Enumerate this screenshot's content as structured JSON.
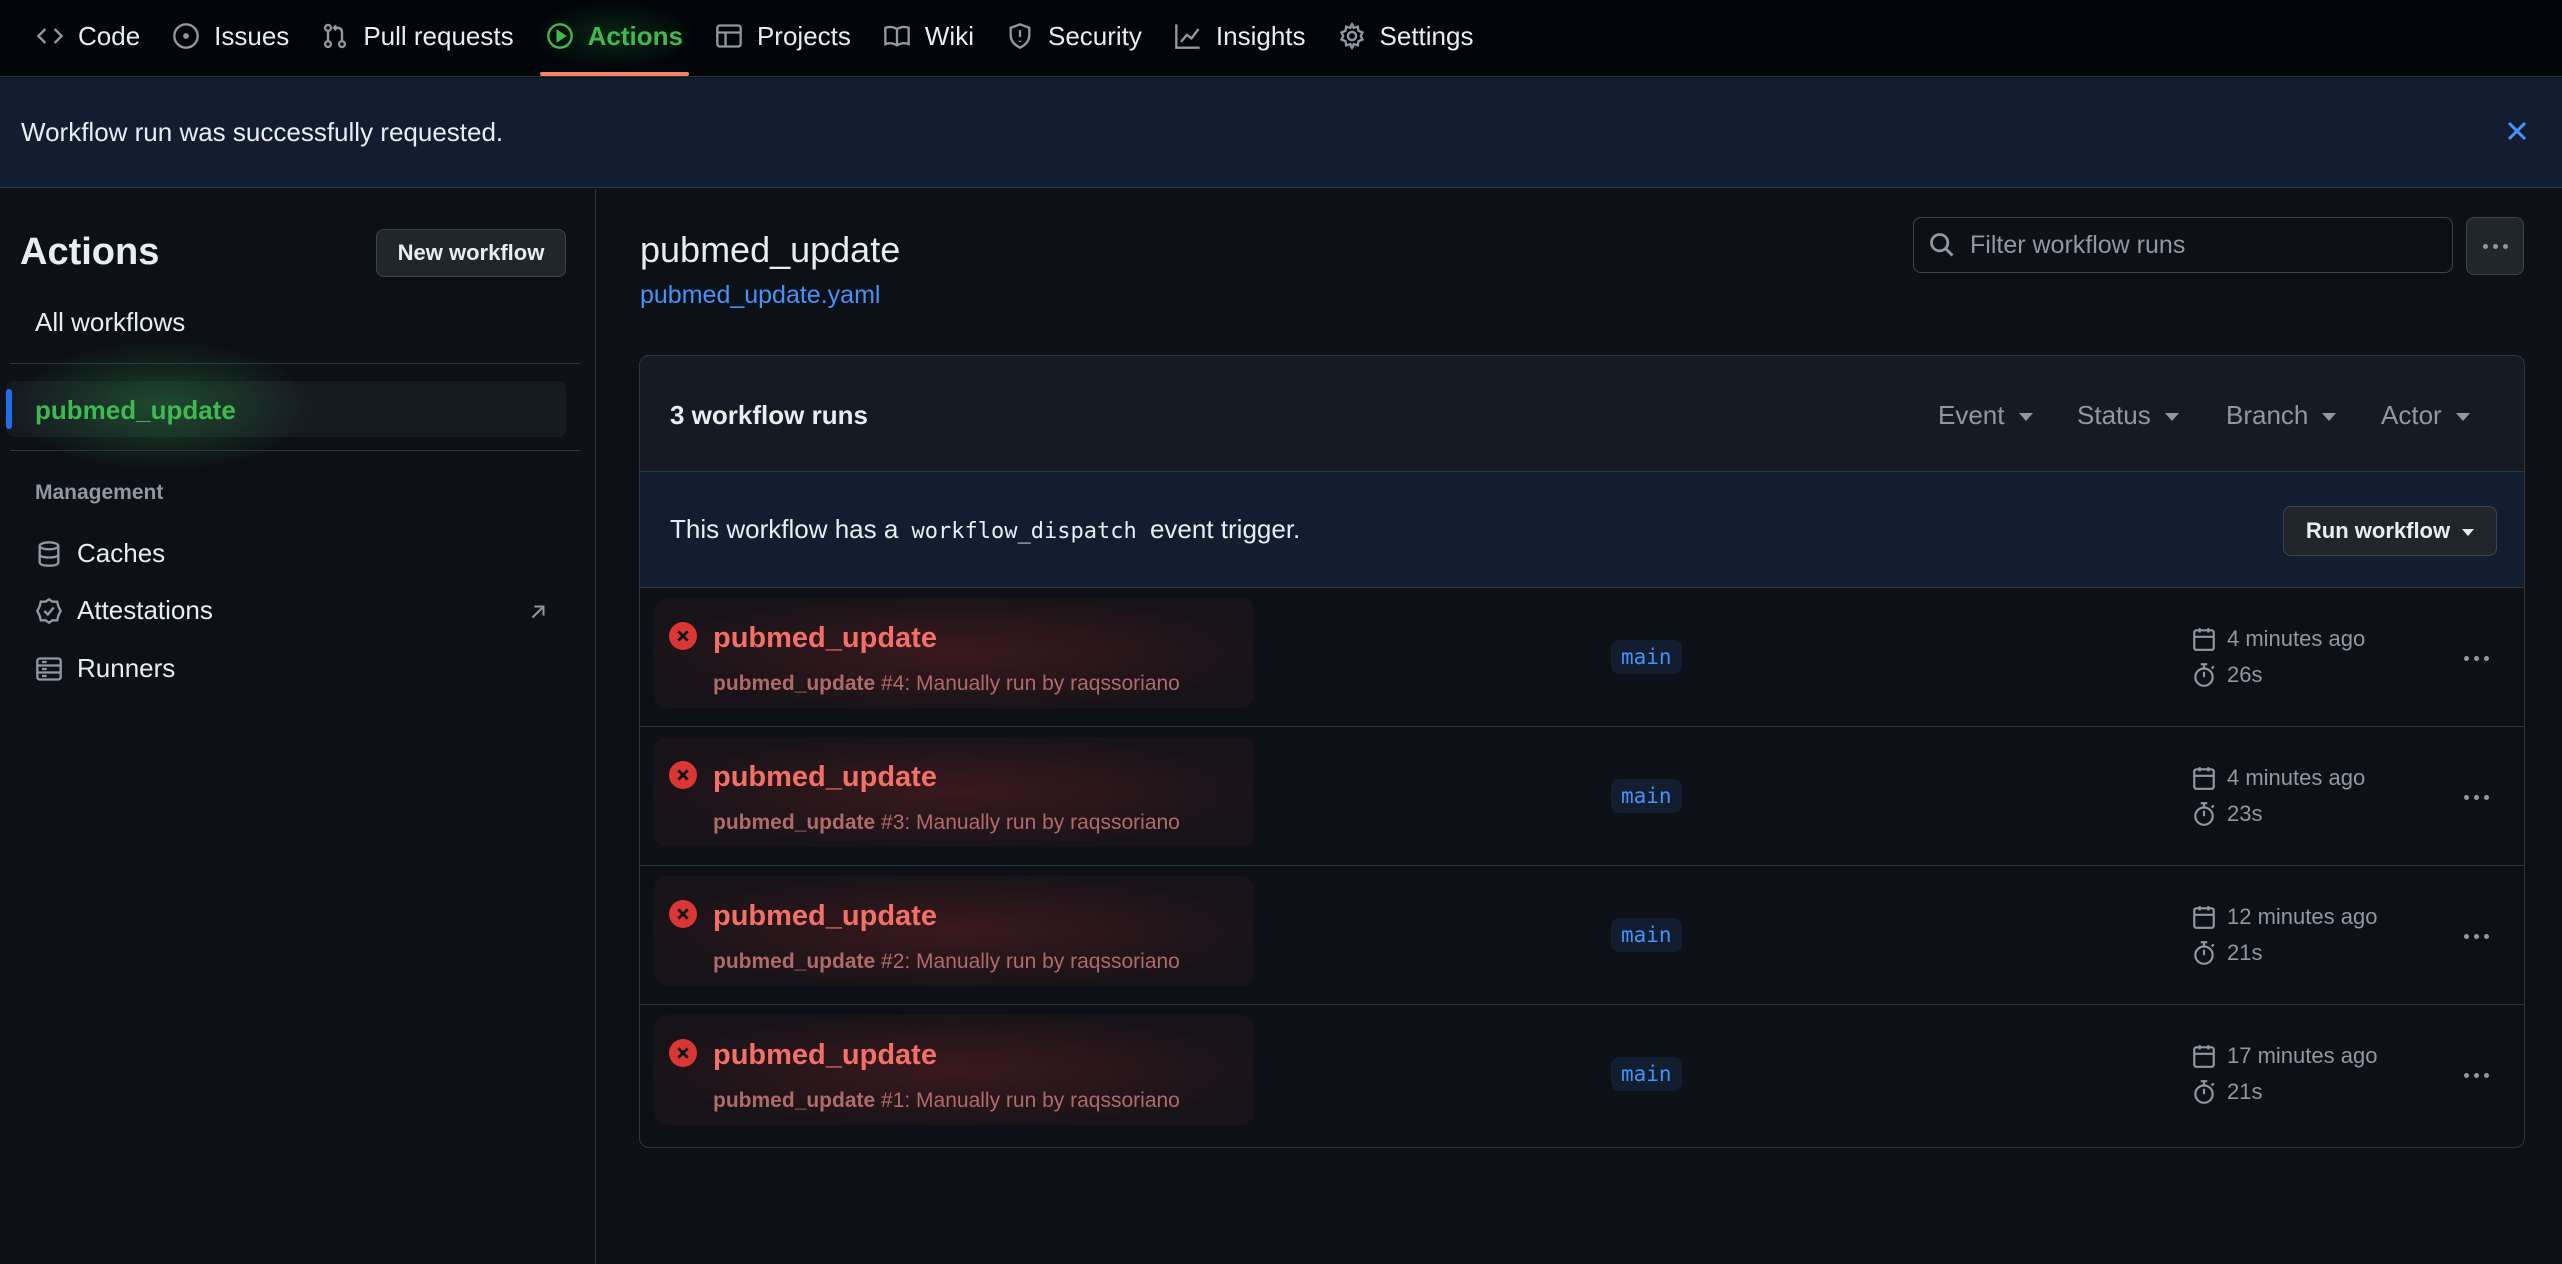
{
  "nav": {
    "tabs": [
      {
        "label": "Code",
        "icon": "code-icon"
      },
      {
        "label": "Issues",
        "icon": "issue-opened-icon"
      },
      {
        "label": "Pull requests",
        "icon": "git-pull-request-icon"
      },
      {
        "label": "Actions",
        "icon": "play-icon",
        "active": true
      },
      {
        "label": "Projects",
        "icon": "table-icon"
      },
      {
        "label": "Wiki",
        "icon": "book-icon"
      },
      {
        "label": "Security",
        "icon": "shield-icon"
      },
      {
        "label": "Insights",
        "icon": "graph-icon"
      },
      {
        "label": "Settings",
        "icon": "gear-icon"
      }
    ]
  },
  "flash": {
    "message": "Workflow run was successfully requested."
  },
  "sidebar": {
    "title": "Actions",
    "new_workflow": "New workflow",
    "all_workflows": "All workflows",
    "current": "pubmed_update",
    "management_heading": "Management",
    "links": [
      {
        "label": "Caches",
        "icon": "database-icon"
      },
      {
        "label": "Attestations",
        "icon": "verified-icon"
      },
      {
        "label": "Runners",
        "icon": "server-icon"
      }
    ]
  },
  "main": {
    "title": "pubmed_update",
    "file": "pubmed_update.yaml",
    "filter_placeholder": "Filter workflow runs",
    "runs_count": "3 workflow runs",
    "filters": [
      "Event",
      "Status",
      "Branch",
      "Actor"
    ],
    "dispatch": {
      "before": "This workflow has a",
      "code": "workflow_dispatch",
      "after": "event trigger.",
      "button": "Run workflow"
    },
    "runs": [
      {
        "name": "pubmed_update",
        "workflow": "pubmed_update",
        "detail": "#4: Manually run by raqssoriano",
        "branch": "main",
        "when": "4 minutes ago",
        "duration": "26s",
        "status": "failure"
      },
      {
        "name": "pubmed_update",
        "workflow": "pubmed_update",
        "detail": "#3: Manually run by raqssoriano",
        "branch": "main",
        "when": "4 minutes ago",
        "duration": "23s",
        "status": "failure"
      },
      {
        "name": "pubmed_update",
        "workflow": "pubmed_update",
        "detail": "#2: Manually run by raqssoriano",
        "branch": "main",
        "when": "12 minutes ago",
        "duration": "21s",
        "status": "failure"
      },
      {
        "name": "pubmed_update",
        "workflow": "pubmed_update",
        "detail": "#1: Manually run by raqssoriano",
        "branch": "main",
        "when": "17 minutes ago",
        "duration": "21s",
        "status": "failure"
      }
    ]
  },
  "colors": {
    "background": "#0d1117",
    "accent_green": "#3fb950",
    "link_blue": "#4493f8",
    "failure_red": "#f47067"
  }
}
